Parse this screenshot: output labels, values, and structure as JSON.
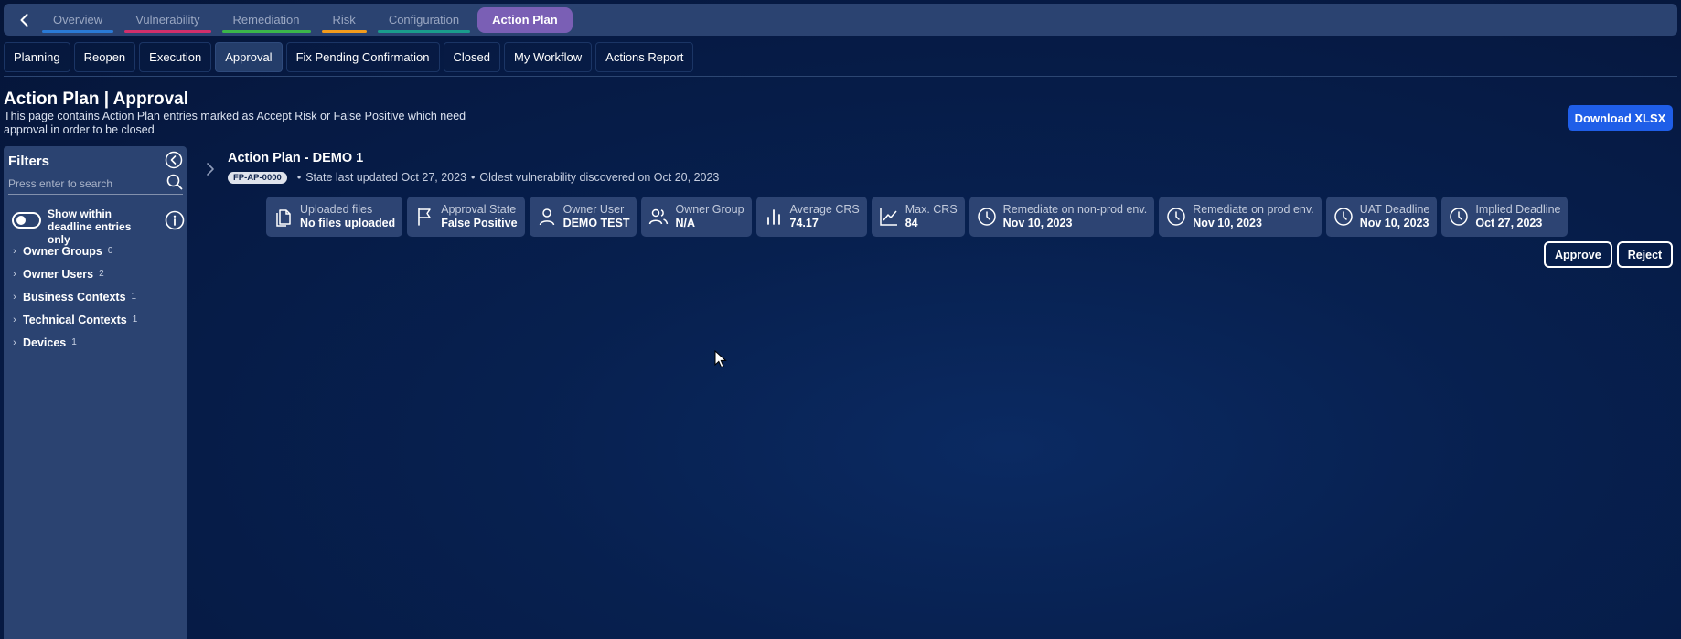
{
  "topnav": {
    "back_icon": "chevron-left-icon",
    "tabs": [
      {
        "label": "Overview",
        "color": "#2a7ad6"
      },
      {
        "label": "Vulnerability",
        "color": "#d12f6b"
      },
      {
        "label": "Remediation",
        "color": "#3bb54a"
      },
      {
        "label": "Risk",
        "color": "#f29b1d"
      },
      {
        "label": "Configuration",
        "color": "#1a9c8c"
      },
      {
        "label": "Action Plan",
        "color": "#7a5fb5",
        "active": true
      }
    ]
  },
  "subnav": {
    "tabs": [
      "Planning",
      "Reopen",
      "Execution",
      "Approval",
      "Fix Pending Confirmation",
      "Closed",
      "My Workflow",
      "Actions Report"
    ],
    "active": "Approval"
  },
  "page": {
    "title": "Action Plan | Approval",
    "description": "This page contains Action Plan entries marked as Accept Risk or False Positive which need approval in order to be closed",
    "download_label": "Download XLSX"
  },
  "filters": {
    "title": "Filters",
    "search_placeholder": "Press enter to search",
    "toggle_label": "Show within deadline entries only",
    "toggle_on": false,
    "facets": [
      {
        "name": "Owner Groups",
        "count": "0"
      },
      {
        "name": "Owner Users",
        "count": "2"
      },
      {
        "name": "Business Contexts",
        "count": "1"
      },
      {
        "name": "Technical Contexts",
        "count": "1"
      },
      {
        "name": "Devices",
        "count": "1"
      }
    ]
  },
  "action_plan": {
    "title": "Action Plan - DEMO 1",
    "id_badge": "FP-AP-0000",
    "state_updated": "State last updated Oct 27, 2023",
    "oldest_vuln": "Oldest vulnerability discovered on Oct 20, 2023",
    "cards": [
      {
        "label": "Uploaded files",
        "value": "No files uploaded",
        "icon": "files-icon"
      },
      {
        "label": "Approval State",
        "value": "False Positive",
        "icon": "flag-icon"
      },
      {
        "label": "Owner User",
        "value": "DEMO TEST",
        "icon": "user-icon"
      },
      {
        "label": "Owner Group",
        "value": "N/A",
        "icon": "users-icon"
      },
      {
        "label": "Average CRS",
        "value": "74.17",
        "icon": "bar-chart-icon"
      },
      {
        "label": "Max. CRS",
        "value": "84",
        "icon": "line-chart-icon"
      },
      {
        "label": "Remediate on non-prod env.",
        "value": "Nov 10, 2023",
        "icon": "clock-icon"
      },
      {
        "label": "Remediate on prod env.",
        "value": "Nov 10, 2023",
        "icon": "clock-icon"
      },
      {
        "label": "UAT Deadline",
        "value": "Nov 10, 2023",
        "icon": "clock-icon"
      },
      {
        "label": "Implied Deadline",
        "value": "Oct 27, 2023",
        "icon": "clock-icon"
      }
    ],
    "approve_label": "Approve",
    "reject_label": "Reject"
  }
}
